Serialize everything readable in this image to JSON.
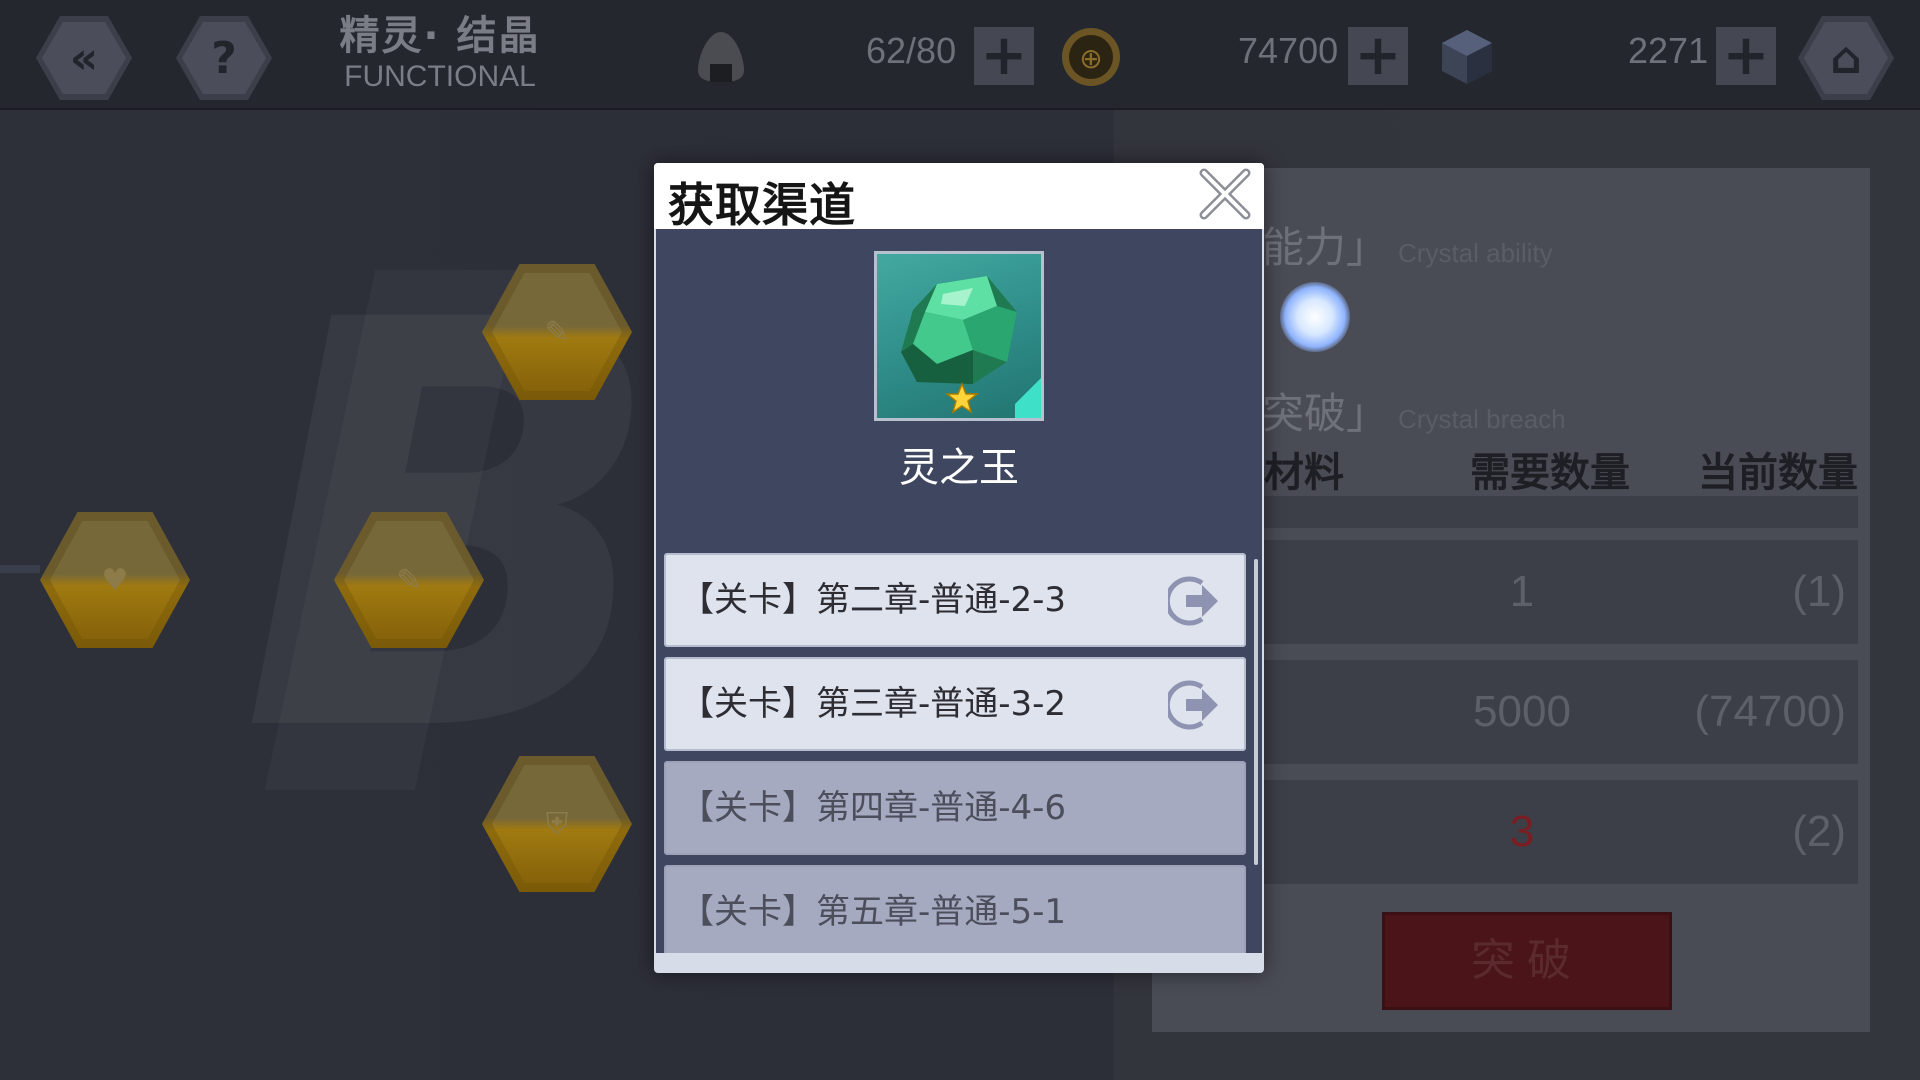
{
  "header": {
    "title_cn": "精灵· 结晶",
    "title_en": "FUNCTIONAL"
  },
  "resources": [
    {
      "icon": "riceball-icon",
      "value": "62/80"
    },
    {
      "icon": "gold-coin-icon",
      "value": "74700"
    },
    {
      "icon": "crystal-cube-icon",
      "value": "2271"
    }
  ],
  "right_panel": {
    "ability_title": "能力」",
    "ability_en": "Crystal ability",
    "breach_title": "突破」",
    "breach_en": "Crystal breach",
    "columns": [
      "材料",
      "需要数量",
      "当前数量"
    ],
    "rows": [
      {
        "need": "1",
        "have": "(1)",
        "need_color": "#5e6069"
      },
      {
        "need": "5000",
        "have": "(74700)",
        "need_color": "#5e6069"
      },
      {
        "need": "3",
        "have": "(2)",
        "need_color": "#7a1d22"
      }
    ],
    "breach_button": "突破"
  },
  "modal": {
    "title": "获取渠道",
    "item_name": "灵之玉",
    "sources": [
      {
        "label": "【关卡】第二章-普通-2-3",
        "available": true
      },
      {
        "label": "【关卡】第三章-普通-3-2",
        "available": true
      },
      {
        "label": "【关卡】第四章-普通-4-6",
        "available": false
      },
      {
        "label": "【关卡】第五章-普通-5-1",
        "available": false
      }
    ]
  }
}
